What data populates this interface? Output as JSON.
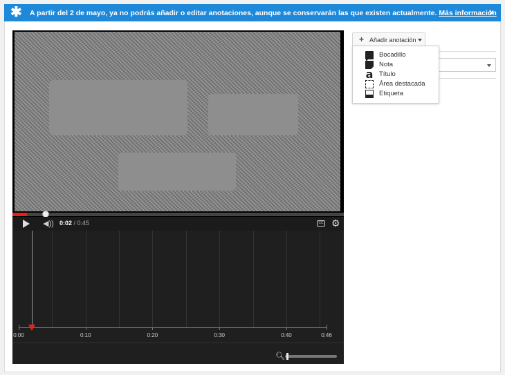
{
  "banner": {
    "icon": "star-icon",
    "message": "A partir del 2 de mayo, ya no podrás añadir o editar anotaciones, aunque se conservarán las que existen actualmente.",
    "link": "Más información",
    "close": "×"
  },
  "player": {
    "current_time": "0:02",
    "duration": "/ 0:45",
    "progress_fraction": 0.044,
    "icons": [
      "play-icon",
      "volume-icon",
      "cc-icon",
      "gear-icon"
    ]
  },
  "timeline": {
    "ticks": [
      {
        "label": "0:00",
        "t": 0
      },
      {
        "label": "0:10",
        "t": 10
      },
      {
        "label": "0:20",
        "t": 20
      },
      {
        "label": "0:30",
        "t": 30
      },
      {
        "label": "0:40",
        "t": 40
      },
      {
        "label": "0:46",
        "t": 46
      }
    ],
    "max_t": 46,
    "playhead_t": 2,
    "zoom_fraction": 0.03
  },
  "annotations": {
    "add_button_label": "Añadir anotación",
    "menu": [
      {
        "icon": "speech-bubble-icon",
        "label": "Bocadillo"
      },
      {
        "icon": "note-icon",
        "label": "Nota"
      },
      {
        "icon": "title-icon",
        "label": "Título"
      },
      {
        "icon": "spotlight-icon",
        "label": "Área destacada"
      },
      {
        "icon": "label-icon",
        "label": "Etiqueta"
      }
    ]
  },
  "colors": {
    "banner_bg": "#1e88d9",
    "progress_red": "#e62117",
    "player_bg": "#1b1b1b"
  }
}
